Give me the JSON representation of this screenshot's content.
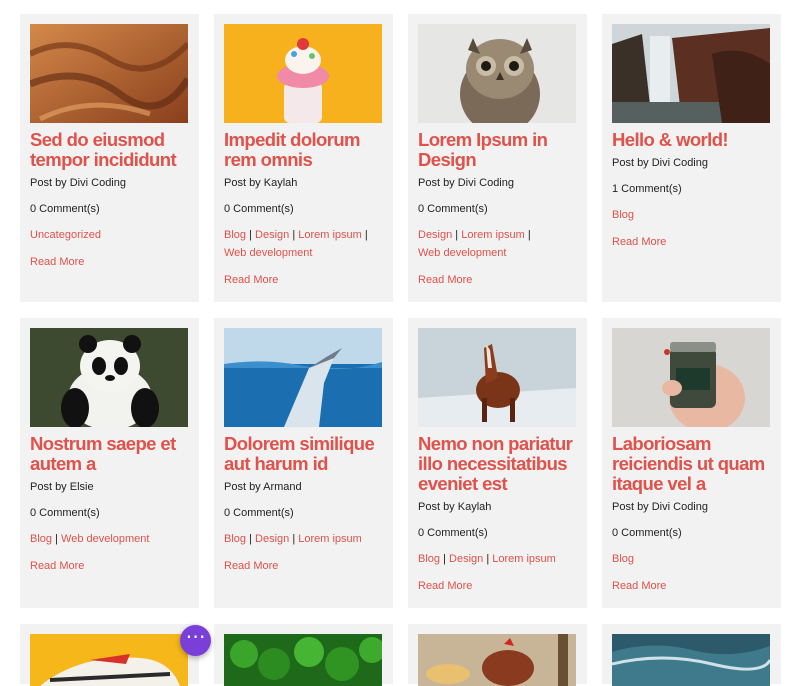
{
  "posts": [
    {
      "title": "Sed do eiusmod tempor incididunt",
      "author": "Post by Divi Coding",
      "comments": "0 Comment(s)",
      "categories": [
        "Uncategorized"
      ],
      "read_more": "Read More",
      "image": "desert-dunes"
    },
    {
      "title": "Impedit dolorum rem omnis",
      "author": "Post by Kaylah",
      "comments": "0 Comment(s)",
      "categories": [
        "Blog",
        "Design",
        "Lorem ipsum",
        "Web development"
      ],
      "read_more": "Read More",
      "image": "milkshake-donut"
    },
    {
      "title": "Lorem Ipsum in Design",
      "author": "Post by Divi Coding",
      "comments": "0 Comment(s)",
      "categories": [
        "Design",
        "Lorem ipsum",
        "Web development"
      ],
      "read_more": "Read More",
      "image": "owl"
    },
    {
      "title": "Hello & world!",
      "author": "Post by Divi Coding",
      "comments": "1 Comment(s)",
      "categories": [
        "Blog"
      ],
      "read_more": "Read More",
      "image": "waterfall"
    },
    {
      "title": "Nostrum saepe et autem a",
      "author": "Post by Elsie",
      "comments": "0 Comment(s)",
      "categories": [
        "Blog",
        "Web development"
      ],
      "read_more": "Read More",
      "image": "panda"
    },
    {
      "title": "Dolorem similique aut harum id",
      "author": "Post by Armand",
      "comments": "0 Comment(s)",
      "categories": [
        "Blog",
        "Design",
        "Lorem ipsum"
      ],
      "read_more": "Read More",
      "image": "whale"
    },
    {
      "title": "Nemo non pariatur illo necessitatibus eveniet est",
      "author": "Post by Kaylah",
      "comments": "0 Comment(s)",
      "categories": [
        "Blog",
        "Design",
        "Lorem ipsum"
      ],
      "read_more": "Read More",
      "image": "horse"
    },
    {
      "title": "Laboriosam reiciendis ut quam itaque vel a",
      "author": "Post by Divi Coding",
      "comments": "0 Comment(s)",
      "categories": [
        "Blog"
      ],
      "read_more": "Read More",
      "image": "jar-in-hand"
    },
    {
      "image": "sneaker"
    },
    {
      "image": "green-peppers"
    },
    {
      "image": "rooster"
    },
    {
      "image": "ocean-wave"
    }
  ],
  "fab": {
    "label": "⋯",
    "icon": "more-dots-icon"
  },
  "colors": {
    "accent": "#e0524a",
    "card": "#f2f2f2",
    "fab": "#7b3fd9"
  }
}
